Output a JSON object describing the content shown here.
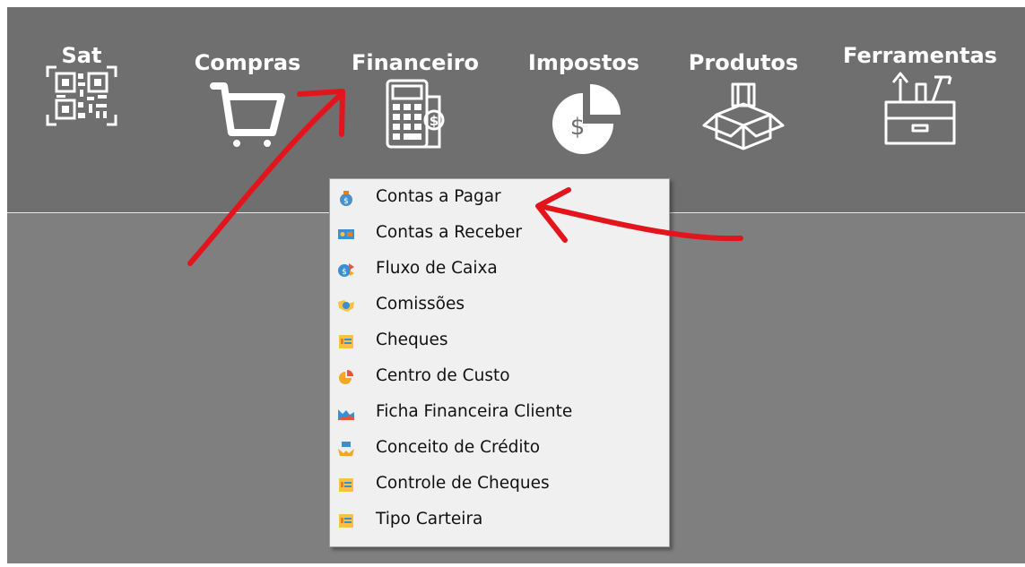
{
  "toolbar": {
    "items": [
      {
        "label": "Sat",
        "icon": "qr-code-icon"
      },
      {
        "label": "Compras",
        "icon": "shopping-cart-icon"
      },
      {
        "label": "Financeiro",
        "icon": "calculator-icon"
      },
      {
        "label": "Impostos",
        "icon": "pie-chart-icon"
      },
      {
        "label": "Produtos",
        "icon": "box-icon"
      },
      {
        "label": "Ferramentas",
        "icon": "toolbox-icon"
      }
    ]
  },
  "menu": {
    "items": [
      {
        "label": "Contas a Pagar",
        "icon": "money-bag-icon"
      },
      {
        "label": "Contas a Receber",
        "icon": "cash-icon"
      },
      {
        "label": "Fluxo de Caixa",
        "icon": "cash-flow-icon"
      },
      {
        "label": "Comissões",
        "icon": "handshake-icon"
      },
      {
        "label": "Cheques",
        "icon": "cheque-icon"
      },
      {
        "label": "Centro de Custo",
        "icon": "pie-icon"
      },
      {
        "label": "Ficha Financeira Cliente",
        "icon": "area-chart-icon"
      },
      {
        "label": "Conceito de Crédito",
        "icon": "credit-hand-icon"
      },
      {
        "label": "Controle de Cheques",
        "icon": "cheque-control-icon"
      },
      {
        "label": "Tipo Carteira",
        "icon": "wallet-type-icon"
      }
    ]
  },
  "colors": {
    "toolbar_bg": "#6f6f6f",
    "content_bg": "#7f7f7f",
    "menu_bg": "#f0f0f0",
    "annotation": "#e3141b"
  }
}
